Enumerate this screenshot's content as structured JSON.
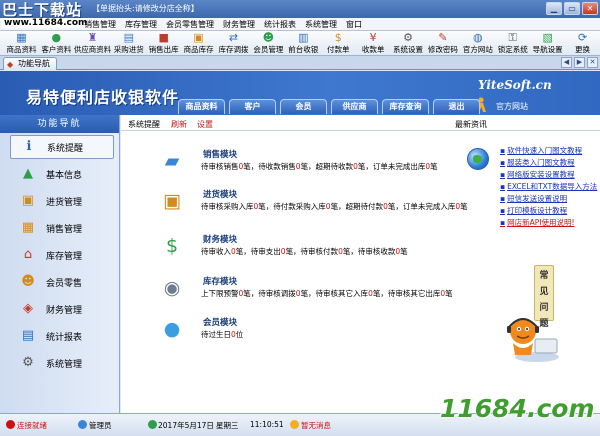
{
  "titlebar": {
    "logo": "巴士下载站",
    "title": "【单据抬头:请修改分店全称】",
    "minimize": "0",
    "maximize": "1",
    "close": "r"
  },
  "menubar": {
    "site": "www.11684.com",
    "items": [
      "销售管理",
      "库存管理",
      "会员零售管理",
      "财务管理",
      "统计报表",
      "系统管理",
      "窗口"
    ]
  },
  "toolbar": {
    "buttons": [
      {
        "label": "商品资料",
        "icon": "product-icon",
        "glyph": "▦",
        "color": "#2f6fc1"
      },
      {
        "label": "客户资料",
        "icon": "customer-icon",
        "glyph": "●",
        "color": "#2f9e4a"
      },
      {
        "label": "供应商资料",
        "icon": "supplier-icon",
        "glyph": "♜",
        "color": "#6b4fb0"
      },
      {
        "label": "采购进货",
        "icon": "purchase-icon",
        "glyph": "▤",
        "color": "#3a7bd5"
      },
      {
        "label": "销售出库",
        "icon": "sales-out-icon",
        "glyph": "■",
        "color": "#c0392b"
      },
      {
        "label": "商品库存",
        "icon": "stock-icon",
        "glyph": "▣",
        "color": "#d48b1d"
      },
      {
        "label": "库存调拨",
        "icon": "transfer-icon",
        "glyph": "⇄",
        "color": "#2f6fc1"
      },
      {
        "label": "会员管理",
        "icon": "member-icon",
        "glyph": "☻",
        "color": "#2f9e4a"
      },
      {
        "label": "前台收银",
        "icon": "cashier-icon",
        "glyph": "▥",
        "color": "#2f6fc1"
      },
      {
        "label": "付款单",
        "icon": "payment-icon",
        "glyph": "$",
        "color": "#d48b1d"
      },
      {
        "label": "收款单",
        "icon": "receipt-icon",
        "glyph": "¥",
        "color": "#c0392b"
      },
      {
        "label": "系统设置",
        "icon": "settings-icon",
        "glyph": "⚙",
        "color": "#555555"
      },
      {
        "label": "修改密码",
        "icon": "password-icon",
        "glyph": "✎",
        "color": "#c0392b"
      },
      {
        "label": "官方网站",
        "icon": "website-icon",
        "glyph": "◍",
        "color": "#2f6fc1"
      },
      {
        "label": "锁定系统",
        "icon": "lock-icon",
        "glyph": "⚿",
        "color": "#555555"
      },
      {
        "label": "导航设置",
        "icon": "nav-settings-icon",
        "glyph": "▧",
        "color": "#2f9e4a"
      },
      {
        "label": "更换",
        "icon": "switch-icon",
        "glyph": "⟳",
        "color": "#2f6fc1"
      }
    ]
  },
  "tabstrip": {
    "active_tab": "功能导航"
  },
  "banner": {
    "brand": "易特便利店收银软件",
    "yite": "YiteSoft.cn",
    "official": "官方网站"
  },
  "navtabs": [
    "商品资料",
    "客户",
    "会员",
    "供应商",
    "库存查询",
    "退出"
  ],
  "sidebar": {
    "header": "功能导航",
    "items": [
      {
        "label": "系统提醒",
        "icon": "info-icon",
        "glyph": "ℹ",
        "color": "#2f5fb0",
        "active": true
      },
      {
        "label": "基本信息",
        "icon": "cubes-icon",
        "glyph": "▲",
        "color": "#2f9e4a"
      },
      {
        "label": "进货管理",
        "icon": "box-icon",
        "glyph": "▣",
        "color": "#d48b1d"
      },
      {
        "label": "销售管理",
        "icon": "box-out-icon",
        "glyph": "▦",
        "color": "#d48b1d"
      },
      {
        "label": "库存管理",
        "icon": "warehouse-icon",
        "glyph": "⌂",
        "color": "#c0392b"
      },
      {
        "label": "会员零售",
        "icon": "member-retail-icon",
        "glyph": "☻",
        "color": "#d48b1d"
      },
      {
        "label": "财务管理",
        "icon": "finance-icon",
        "glyph": "◈",
        "color": "#c0392b"
      },
      {
        "label": "统计报表",
        "icon": "report-icon",
        "glyph": "▤",
        "color": "#2f6fc1"
      },
      {
        "label": "系统管理",
        "icon": "gears-icon",
        "glyph": "⚙",
        "color": "#555555"
      }
    ]
  },
  "main": {
    "sys_remind": "系统提醒",
    "refresh": "刷新",
    "setting": "设置",
    "news_title": "最新资讯",
    "modules": [
      {
        "title": "销售模块",
        "icon": "sales-module-icon",
        "glyph": "▰",
        "color": "#3a86d6",
        "desc": [
          "待审核销售",
          "0",
          "笔，待收款销售",
          "0",
          "笔，超期待收款",
          "0",
          "笔，订单未完成出库",
          "0",
          "笔"
        ]
      },
      {
        "title": "进货模块",
        "icon": "purchase-module-icon",
        "glyph": "▣",
        "color": "#d48b1d",
        "desc": [
          "待审核采购入库",
          "0",
          "笔，待付款采购入库",
          "0",
          "笔，超期待付款",
          "0",
          "笔，订单未完成入库",
          "0",
          "笔"
        ]
      },
      {
        "title": "财务模块",
        "icon": "finance-module-icon",
        "glyph": "$",
        "color": "#2f9e4a",
        "desc": [
          "待审收入",
          "0",
          "笔，待审支出",
          "0",
          "笔，待审核付款",
          "0",
          "笔，待审核收款",
          "0",
          "笔"
        ]
      },
      {
        "title": "库存模块",
        "icon": "stock-module-icon",
        "glyph": "◉",
        "color": "#6d7d8f",
        "desc": [
          "上下限预警",
          "0",
          "笔，待审核调拨",
          "0",
          "笔，待审核其它入库",
          "0",
          "笔，待审核其它出库",
          "0",
          "笔"
        ]
      },
      {
        "title": "会员模块",
        "icon": "member-module-icon",
        "glyph": "●",
        "color": "#3a9fe0",
        "desc": [
          "待过生日",
          "0",
          "位"
        ]
      }
    ],
    "news": [
      {
        "text": "软件快速入门图文教程",
        "hot": false
      },
      {
        "text": "服装类入门图文教程",
        "hot": false
      },
      {
        "text": "网络版安装设置教程",
        "hot": false
      },
      {
        "text": "EXCEL和TXT数据导入方法",
        "hot": false
      },
      {
        "text": "短信发送设置说明",
        "hot": false
      },
      {
        "text": "打印模板设计教程",
        "hot": false
      },
      {
        "text": "网店新API使用说明!",
        "hot": true
      }
    ],
    "faq": [
      "常",
      "见",
      "问",
      "题"
    ]
  },
  "statusbar": {
    "status": "连接就绪",
    "user": "管理员",
    "date": "2017年5月17日",
    "weekday": "星期三",
    "time": "11:10:51",
    "msg": "暂无消息"
  },
  "watermark": {
    "text": "11684.com"
  }
}
